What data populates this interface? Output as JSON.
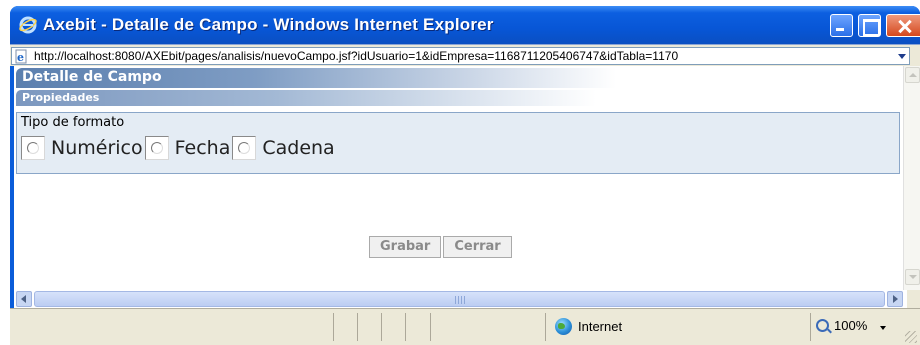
{
  "window": {
    "title": "Axebit - Detalle de Campo - Windows Internet Explorer",
    "icon": "ie-icon",
    "controls": [
      "minimize-icon",
      "maximize-icon",
      "close-icon"
    ]
  },
  "addressbar": {
    "url": "http://localhost:8080/AXEbit/pages/analisis/nuevoCampo.jsf?idUsuario=1&idEmpresa=1168711205406747&idTabla=1170"
  },
  "page": {
    "header": "Detalle de Campo",
    "section": "Propiedades",
    "fieldset": {
      "legend": "Tipo de formato",
      "options": [
        {
          "label": "Numérico",
          "checked": false
        },
        {
          "label": "Fecha",
          "checked": false
        },
        {
          "label": "Cadena",
          "checked": false
        }
      ]
    },
    "buttons": {
      "save": "Grabar",
      "close": "Cerrar"
    }
  },
  "statusbar": {
    "zone": "Internet",
    "zoom": "100%"
  },
  "colors": {
    "titlebar": "#0856d6",
    "header_gradient": "#5b7fae",
    "fieldset_bg": "#e4ecf4"
  }
}
